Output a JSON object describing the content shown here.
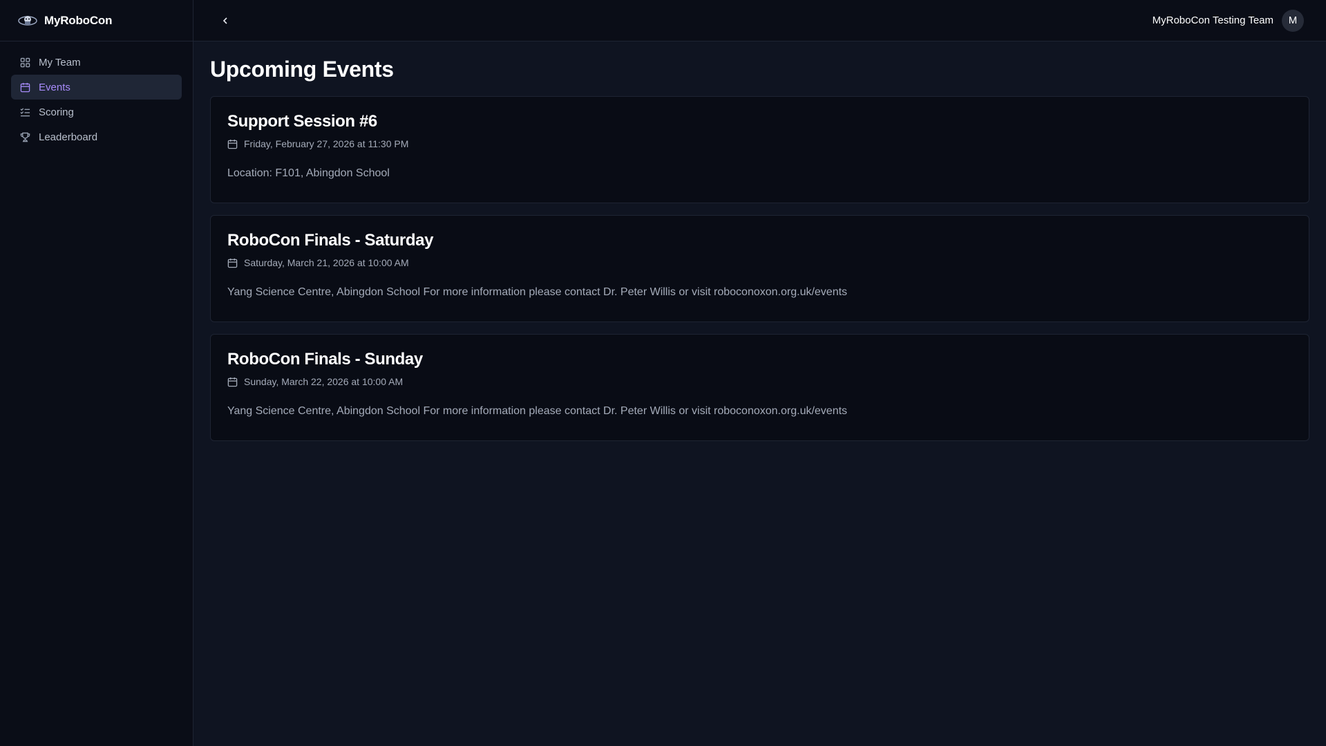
{
  "brand": {
    "name": "MyRoboCon"
  },
  "sidebar": {
    "items": [
      {
        "label": "My Team",
        "icon": "grid-icon"
      },
      {
        "label": "Events",
        "icon": "calendar-icon",
        "active": true
      },
      {
        "label": "Scoring",
        "icon": "list-checks-icon"
      },
      {
        "label": "Leaderboard",
        "icon": "trophy-icon"
      }
    ]
  },
  "topbar": {
    "team_name": "MyRoboCon Testing Team",
    "avatar_initial": "M"
  },
  "main": {
    "title": "Upcoming Events",
    "events": [
      {
        "title": "Support Session #6",
        "date": "Friday, February 27, 2026 at 11:30 PM",
        "location": "Location: F101, Abingdon School"
      },
      {
        "title": "RoboCon Finals - Saturday",
        "date": "Saturday, March 21, 2026 at 10:00 AM",
        "location": "Yang Science Centre, Abingdon School For more information please contact Dr. Peter Willis or visit roboconoxon.org.uk/events"
      },
      {
        "title": "RoboCon Finals - Sunday",
        "date": "Sunday, March 22, 2026 at 10:00 AM",
        "location": "Yang Science Centre, Abingdon School For more information please contact Dr. Peter Willis or visit roboconoxon.org.uk/events"
      }
    ]
  },
  "colors": {
    "accent": "#a78bfa",
    "background": "#0f1421",
    "sidebar": "#0a0d17"
  }
}
